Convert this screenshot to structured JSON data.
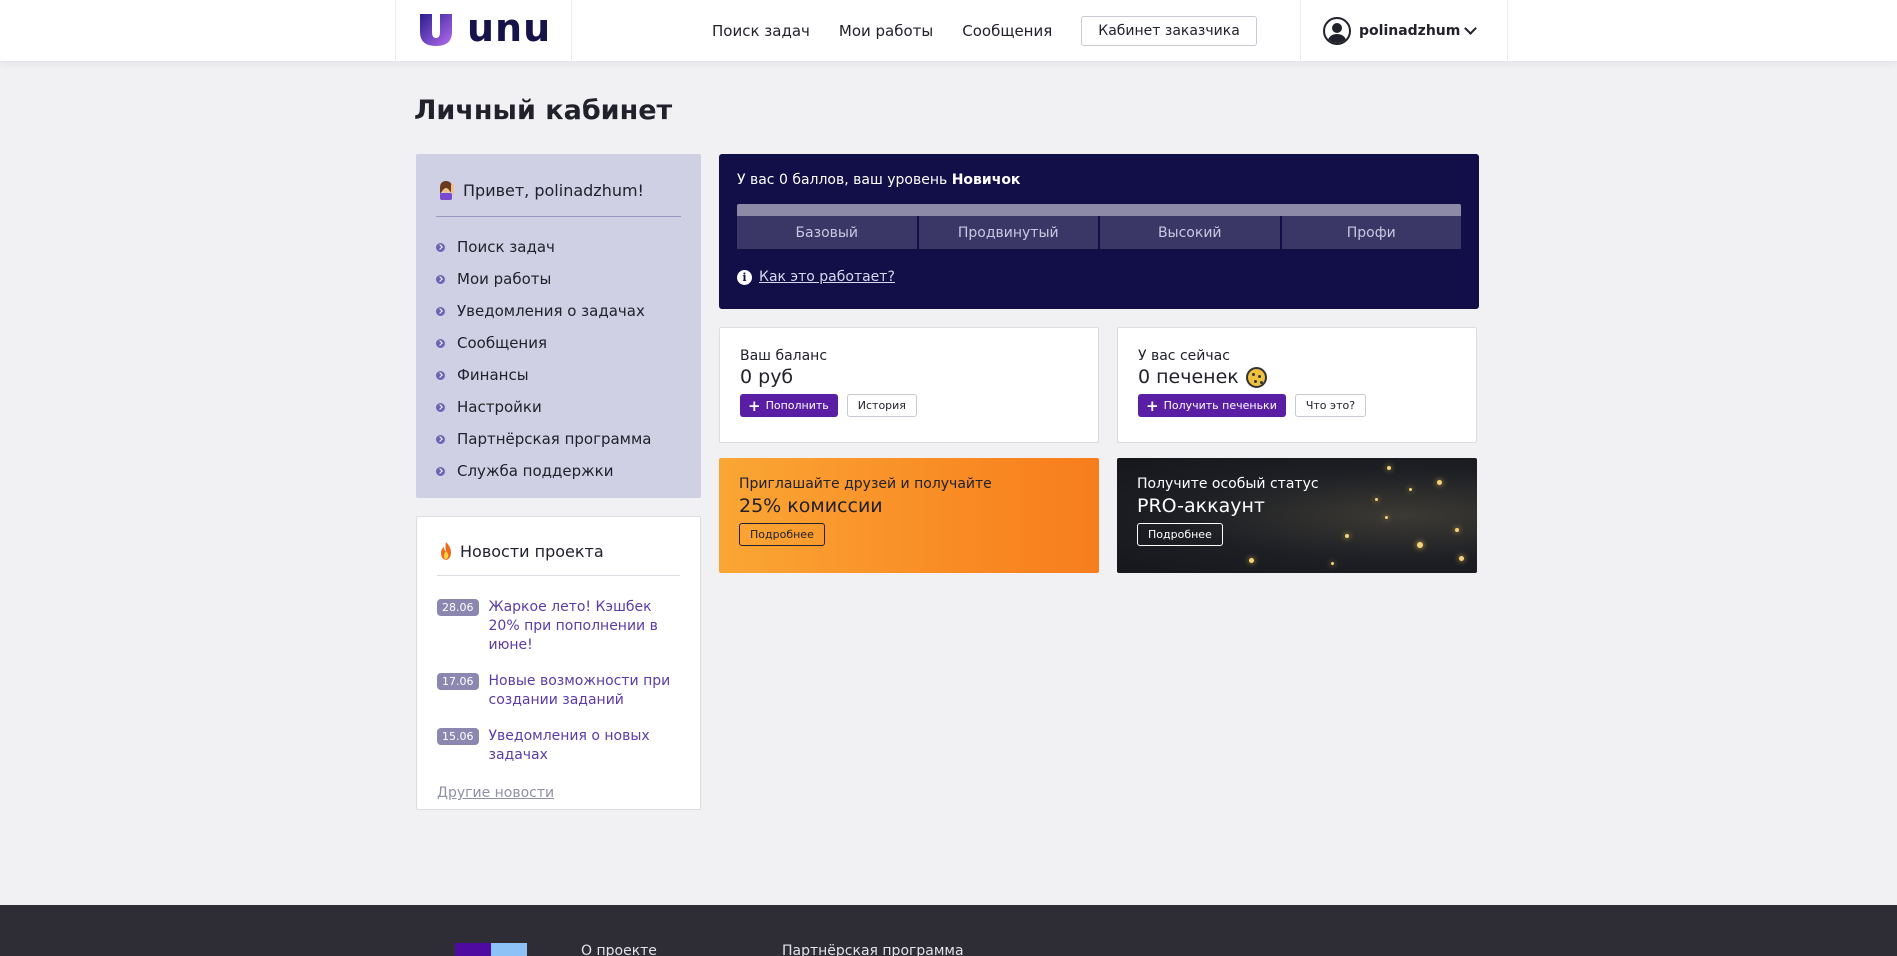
{
  "header": {
    "logo_text": "unu",
    "nav": [
      "Поиск задач",
      "Мои работы",
      "Сообщения"
    ],
    "cabinet_button": "Кабинет заказчика",
    "username": "polinadzhum"
  },
  "page_title": "Личный кабинет",
  "sidebar": {
    "greeting": "Привет, polinadzhum!",
    "items": [
      {
        "label": "Поиск задач"
      },
      {
        "label": "Мои работы"
      },
      {
        "label": "Уведомления о задачах"
      },
      {
        "label": "Сообщения"
      },
      {
        "label": "Финансы"
      },
      {
        "label": "Настройки"
      },
      {
        "label": "Партнёрская программа"
      },
      {
        "label": "Служба поддержки"
      }
    ]
  },
  "news": {
    "title": "Новости проекта",
    "items": [
      {
        "date": "28.06",
        "text": "Жаркое лето! Кэшбек 20% при пополнении в июне!"
      },
      {
        "date": "17.06",
        "text": "Новые возможности при создании заданий"
      },
      {
        "date": "15.06",
        "text": "Уведомления о новых задачах"
      }
    ],
    "more_link": "Другие новости"
  },
  "level": {
    "text_prefix": "У вас 0 баллов, ваш уровень",
    "level_name": "Новичок",
    "progress": 0,
    "levels": [
      "Базовый",
      "Продвинутый",
      "Высокий",
      "Профи"
    ],
    "how_link": "Как это работает?"
  },
  "balance": {
    "label": "Ваш баланс",
    "value": "0 руб",
    "topup_button": "Пополнить",
    "history_button": "История"
  },
  "cookies": {
    "label": "У вас сейчас",
    "value": "0 печенек",
    "get_button": "Получить печеньки",
    "what_button": "Что это?"
  },
  "promo_invite": {
    "subtitle": "Приглашайте друзей и получайте",
    "headline": "25% комиссии",
    "button": "Подробнее"
  },
  "promo_pro": {
    "subtitle": "Получите особый статус",
    "headline": "PRO-аккаунт",
    "button": "Подробнее"
  },
  "footer": {
    "links": [
      "О проекте",
      "Партнёрская программа"
    ]
  },
  "colors": {
    "brand_purple": "#5a1ea4",
    "level_card_bg": "#110e48",
    "sidebar_bg": "#d0d0e4",
    "orange": "#f98c25"
  }
}
